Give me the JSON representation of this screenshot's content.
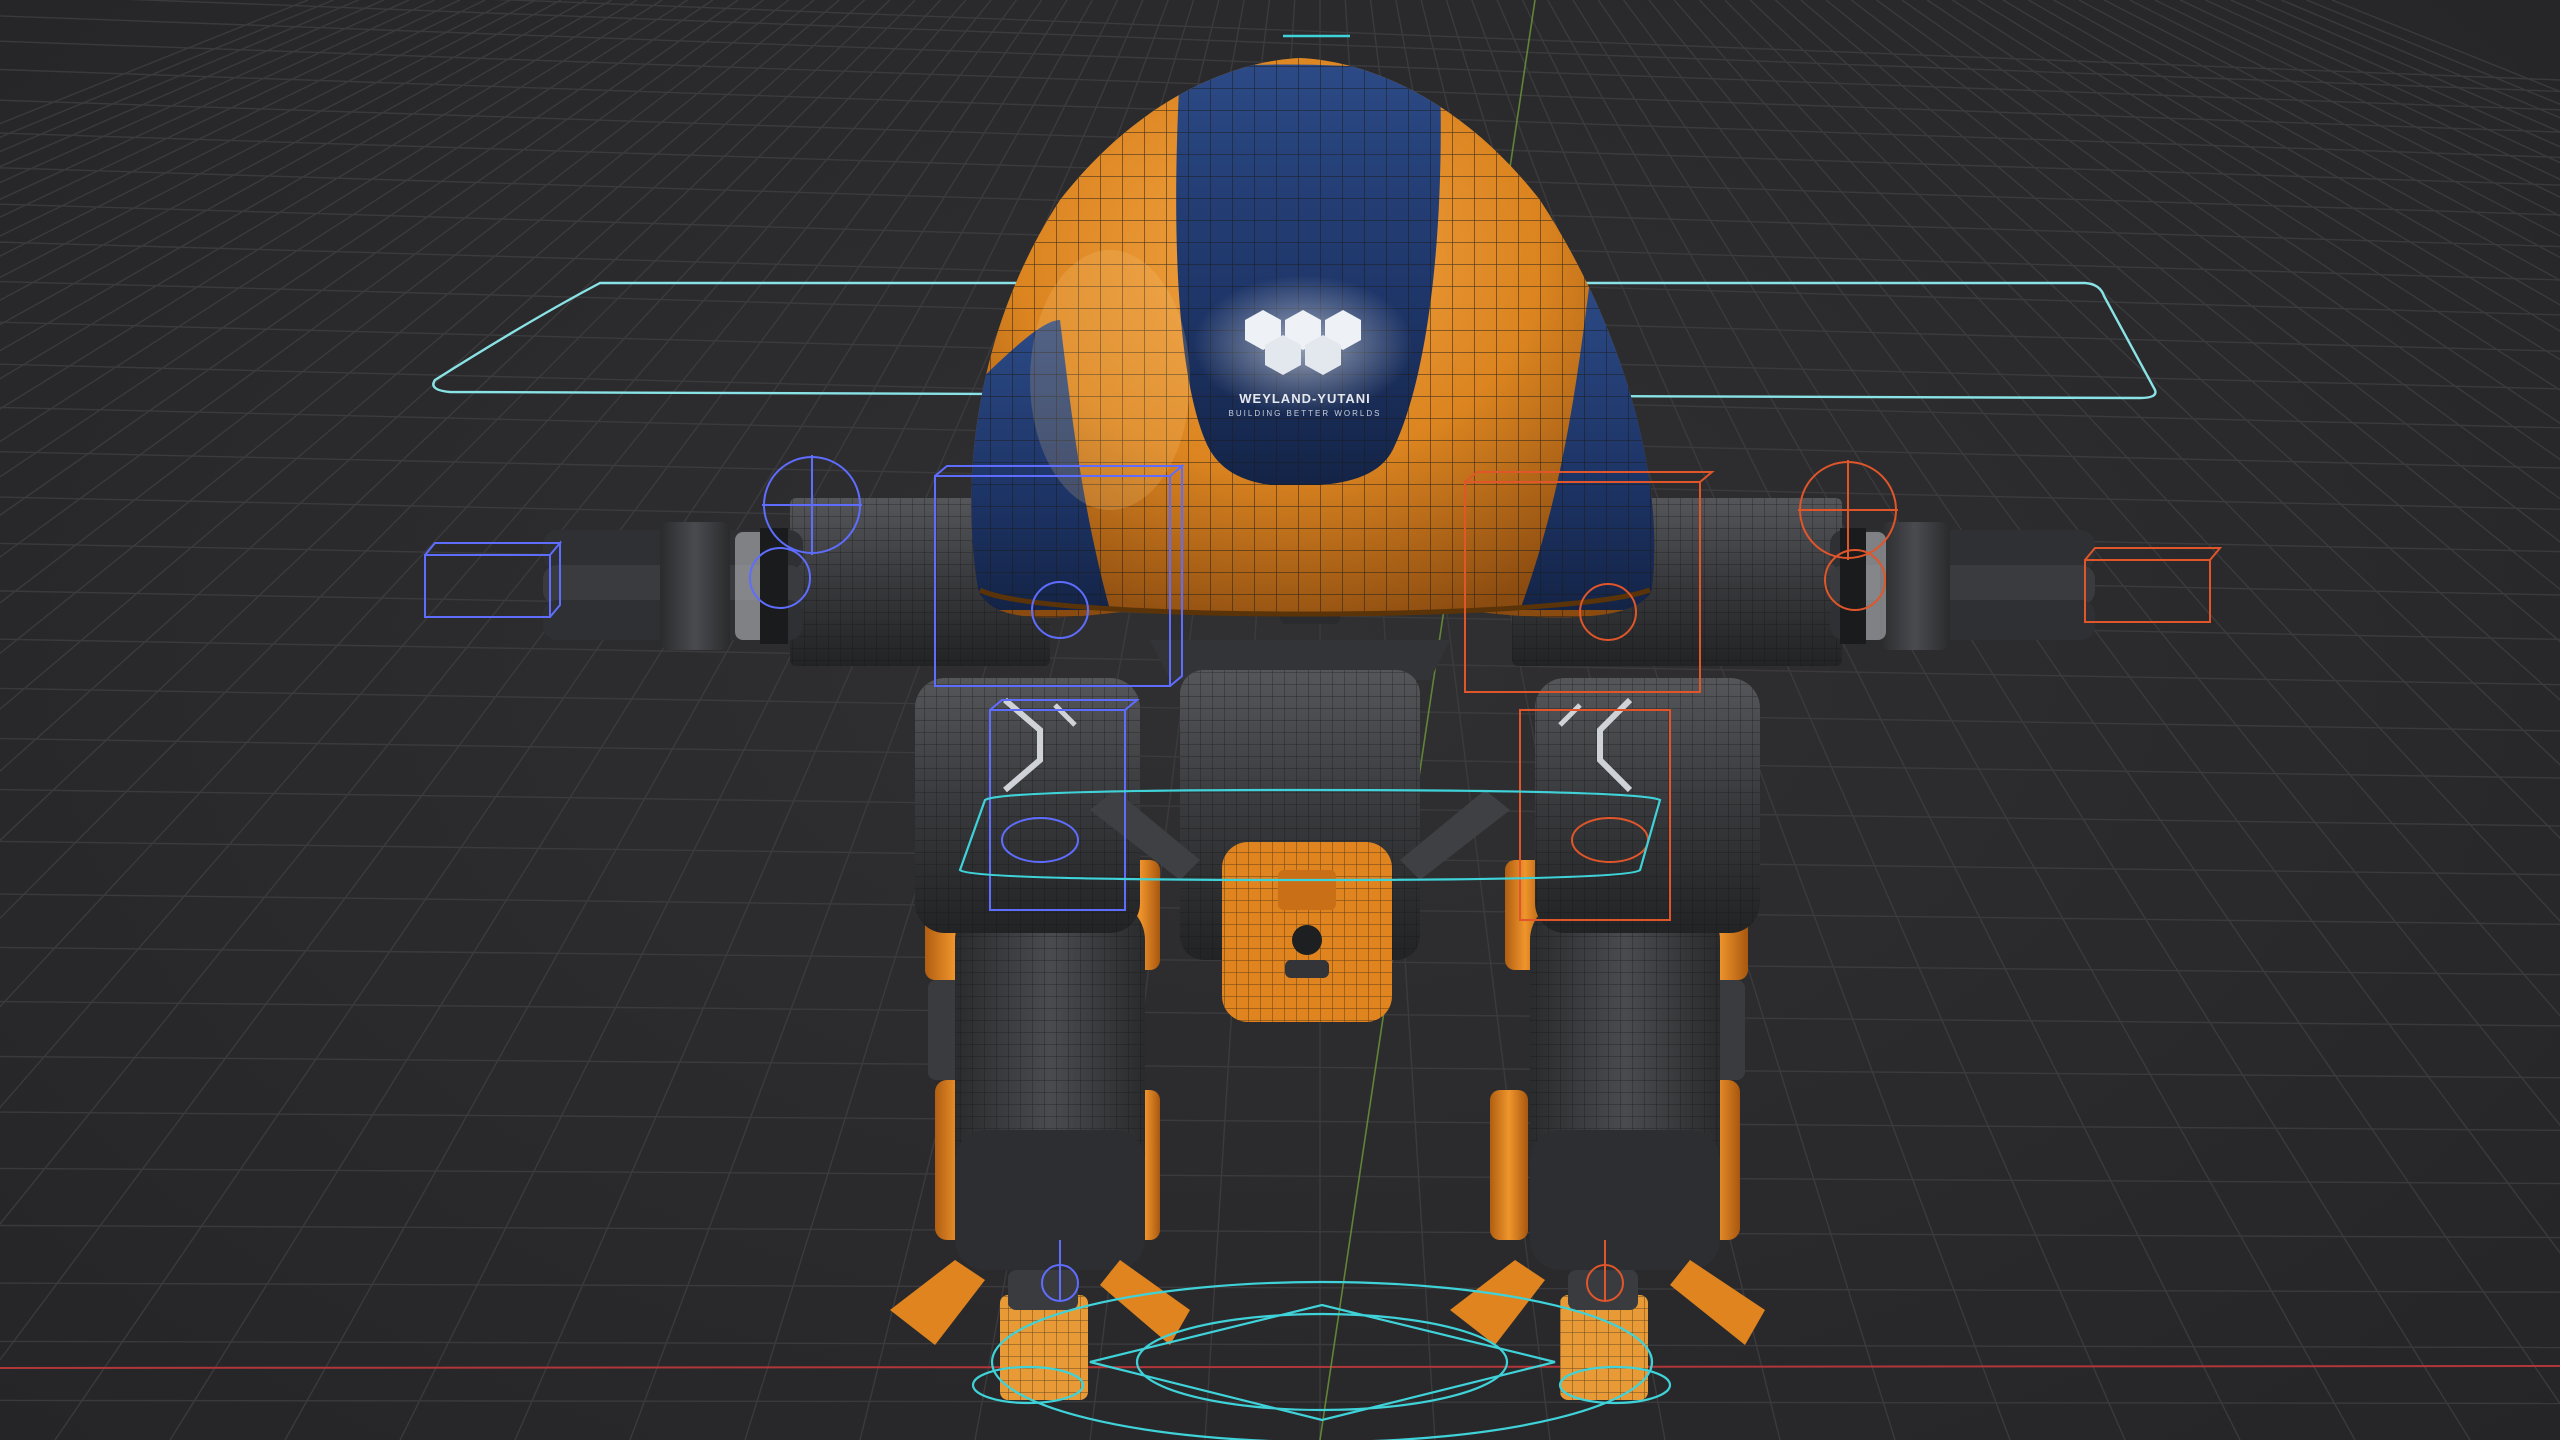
{
  "viewport": {
    "background": "#2b2b2d",
    "grid_color": "#3d3d40",
    "axis_x_color": "#b0363a",
    "axis_y_color": "#6f9a3a"
  },
  "model": {
    "body_primary_color": "#e0841f",
    "body_secondary_color": "#1f3766",
    "metal_color": "#3a3b3e",
    "wireframe_color": "#1a1a1a",
    "logo": {
      "name": "WEYLAND-YUTANI",
      "tagline": "BUILDING BETTER WORLDS"
    }
  },
  "rig": {
    "left_controls_color": "#5f6dff",
    "right_controls_color": "#e0562a",
    "center_controls_color": "#3fd3d9",
    "root_control_color": "#89e3e6"
  }
}
